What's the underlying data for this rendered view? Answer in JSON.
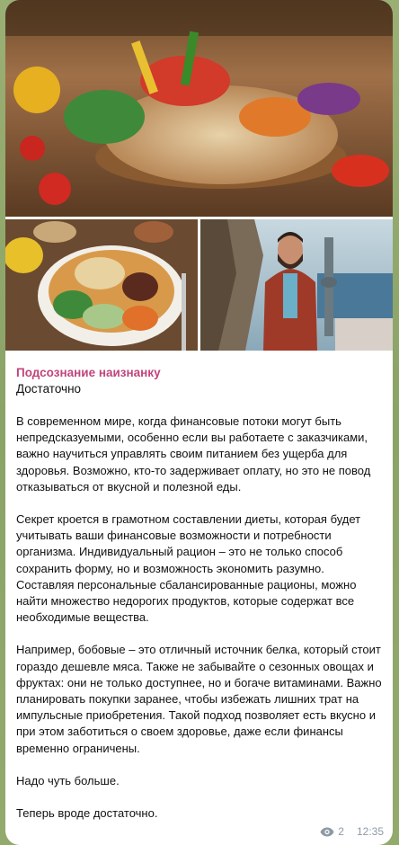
{
  "post": {
    "author": "Подсознание наизнанку",
    "subtitle": "Достаточно",
    "paragraphs": [
      "В современном мире, когда финансовые потоки могут быть непредсказуемыми, особенно если вы работаете с заказчиками, важно научиться управлять своим питанием без ущерба для здоровья. Возможно, кто-то задерживает оплату, но это не повод отказываться от вкусной и полезной еды.",
      "Секрет кроется в грамотном составлении диеты, которая будет учитывать ваши финансовые возможности и потребности организма. Индивидуальный рацион – это не только способ сохранить форму, но и возможность экономить разумно. Составляя персональные сбалансированные рационы, можно найти множество недорогих продуктов, которые содержат все необходимые вещества.",
      "Например, бобовые – это отличный источник белка, который стоит гораздо дешевле мяса. Также не забывайте о сезонных овощах и фруктах: они не только доступнее, но и богаче витаминами. Важно планировать покупки заранее, чтобы избежать лишних трат на импульсные приобретения. Такой подход позволяет есть вкусно и при этом заботиться о своем здоровье, даже если финансы временно ограничены.",
      "Надо чуть больше.",
      "Теперь вроде достаточно."
    ],
    "views": "2",
    "time": "12:35"
  },
  "media": {
    "photos": [
      "vegetables-and-beans-photo",
      "plate-of-food-photo",
      "man-in-red-suit-photo"
    ]
  },
  "colors": {
    "author": "#c0457a",
    "meta": "#8d9aa6",
    "background": "#8ea56a"
  }
}
